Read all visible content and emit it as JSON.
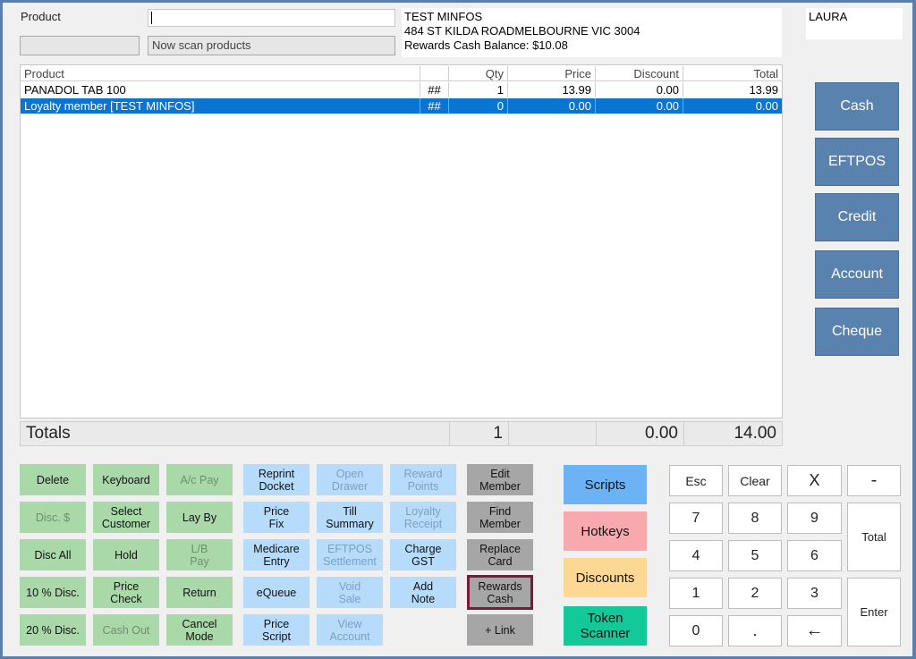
{
  "product_label": "Product",
  "product_input_value": "",
  "status_text": "Now scan products",
  "customer": {
    "name": "TEST MINFOS",
    "address": "484 ST KILDA ROADMELBOURNE VIC 3004",
    "rewards": "Rewards Cash Balance: $10.08"
  },
  "user": "LAURA",
  "grid": {
    "headers": [
      "Product",
      "",
      "Qty",
      "Price",
      "Discount",
      "Total"
    ],
    "rows": [
      {
        "product": "PANADOL TAB 100",
        "mark": "##",
        "qty": "1",
        "price": "13.99",
        "discount": "0.00",
        "total": "13.99"
      },
      {
        "product": "Loyalty member [TEST MINFOS]",
        "mark": "##",
        "qty": "0",
        "price": "0.00",
        "discount": "0.00",
        "total": "0.00"
      }
    ]
  },
  "totals": {
    "label": "Totals",
    "qty": "1",
    "discount": "0.00",
    "total": "14.00"
  },
  "payments": [
    "Cash",
    "EFTPOS",
    "Credit",
    "Account",
    "Cheque"
  ],
  "buttons": {
    "delete": "Delete",
    "keyboard": "Keyboard",
    "ac_pay": "A/c Pay",
    "disc_dollar": "Disc. $",
    "select_customer": "Select\nCustomer",
    "lay_by": "Lay By",
    "disc_all": "Disc All",
    "hold": "Hold",
    "lb_pay": "L/B\nPay",
    "disc10": "10 % Disc.",
    "price_check": "Price\nCheck",
    "return": "Return",
    "disc20": "20 % Disc.",
    "cash_out": "Cash Out",
    "cancel_mode": "Cancel\nMode",
    "reprint_docket": "Reprint\nDocket",
    "open_drawer": "Open\nDrawer",
    "reward_points": "Reward\nPoints",
    "price_fix": "Price\nFix",
    "till_summary": "Till\nSummary",
    "loyalty_receipt": "Loyalty\nReceipt",
    "medicare_entry": "Medicare\nEntry",
    "eftpos_settlement": "EFTPOS\nSettlement",
    "charge_gst": "Charge\nGST",
    "equeue": "eQueue",
    "void_sale": "Void\nSale",
    "add_note": "Add\nNote",
    "price_script": "Price\nScript",
    "view_account": "View\nAccount",
    "edit_member": "Edit\nMember",
    "find_member": "Find\nMember",
    "replace_card": "Replace\nCard",
    "rewards_cash": "Rewards\nCash",
    "link": "+ Link"
  },
  "side_buttons": {
    "scripts": "Scripts",
    "hotkeys": "Hotkeys",
    "discounts": "Discounts",
    "token_scanner": "Token\nScanner"
  },
  "keypad": {
    "esc": "Esc",
    "clear": "Clear",
    "x": "X",
    "minus": "-",
    "k7": "7",
    "k8": "8",
    "k9": "9",
    "total": "Total",
    "k4": "4",
    "k5": "5",
    "k6": "6",
    "k1": "1",
    "k2": "2",
    "k3": "3",
    "enter": "Enter",
    "k0": "0",
    "dot": ".",
    "back": "←"
  },
  "colors": {
    "green": "#a9d8a9",
    "blue": "#b7dcfb",
    "gray": "#a6a6a6",
    "pay": "#5a82ae",
    "scripts": "#6bb3f5",
    "hotkeys": "#f8a9ae",
    "discounts": "#fdd892",
    "token": "#13c99a",
    "selection": "#0a74d2",
    "highlight": "#7a1a3a"
  }
}
